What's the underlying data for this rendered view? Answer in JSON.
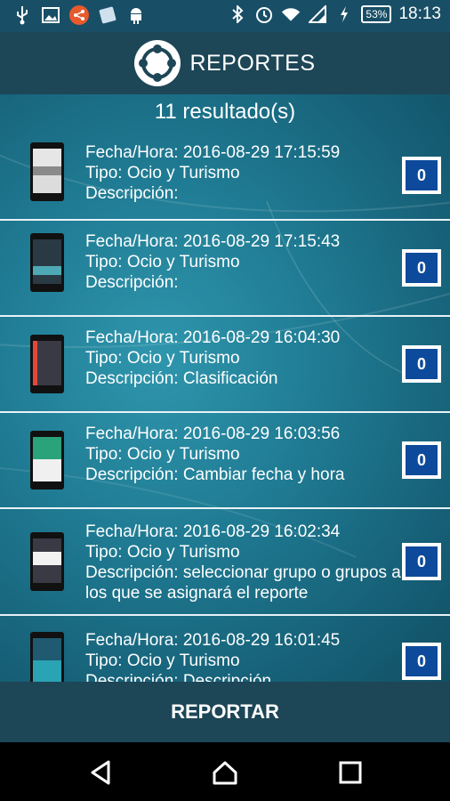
{
  "statusbar": {
    "left_icons": [
      "usb-icon",
      "image-icon",
      "share-icon",
      "card-icon",
      "android-icon"
    ],
    "right_icons": [
      "bluetooth-icon",
      "alarm-icon",
      "wifi-icon",
      "signal-icon"
    ],
    "battery": "53%",
    "time": "18:13"
  },
  "appbar": {
    "title": "REPORTES"
  },
  "results": {
    "count_label": "11 resultado(s)"
  },
  "items": [
    {
      "fecha": "Fecha/Hora: 2016-08-29 17:15:59",
      "tipo": "Tipo: Ocio y Turismo",
      "descripcion": "Descripción:",
      "badge": "0"
    },
    {
      "fecha": "Fecha/Hora: 2016-08-29 17:15:43",
      "tipo": "Tipo: Ocio y Turismo",
      "descripcion": "Descripción:",
      "badge": "0"
    },
    {
      "fecha": "Fecha/Hora: 2016-08-29 16:04:30",
      "tipo": "Tipo: Ocio y Turismo",
      "descripcion": "Descripción: Clasificación",
      "badge": "0"
    },
    {
      "fecha": "Fecha/Hora: 2016-08-29 16:03:56",
      "tipo": "Tipo: Ocio y Turismo",
      "descripcion": "Descripción: Cambiar fecha y hora",
      "badge": "0"
    },
    {
      "fecha": "Fecha/Hora: 2016-08-29 16:02:34",
      "tipo": "Tipo: Ocio y Turismo",
      "descripcion": "Descripción: seleccionar grupo o grupos a los que se asignará el reporte",
      "badge": "0"
    },
    {
      "fecha": "Fecha/Hora: 2016-08-29 16:01:45",
      "tipo": "Tipo: Ocio y Turismo",
      "descripcion": "Descripción: Descripción",
      "badge": "0"
    }
  ],
  "report_button": {
    "label": "REPORTAR"
  },
  "navbar": {
    "icons": [
      "back-icon",
      "home-icon",
      "recents-icon"
    ]
  }
}
